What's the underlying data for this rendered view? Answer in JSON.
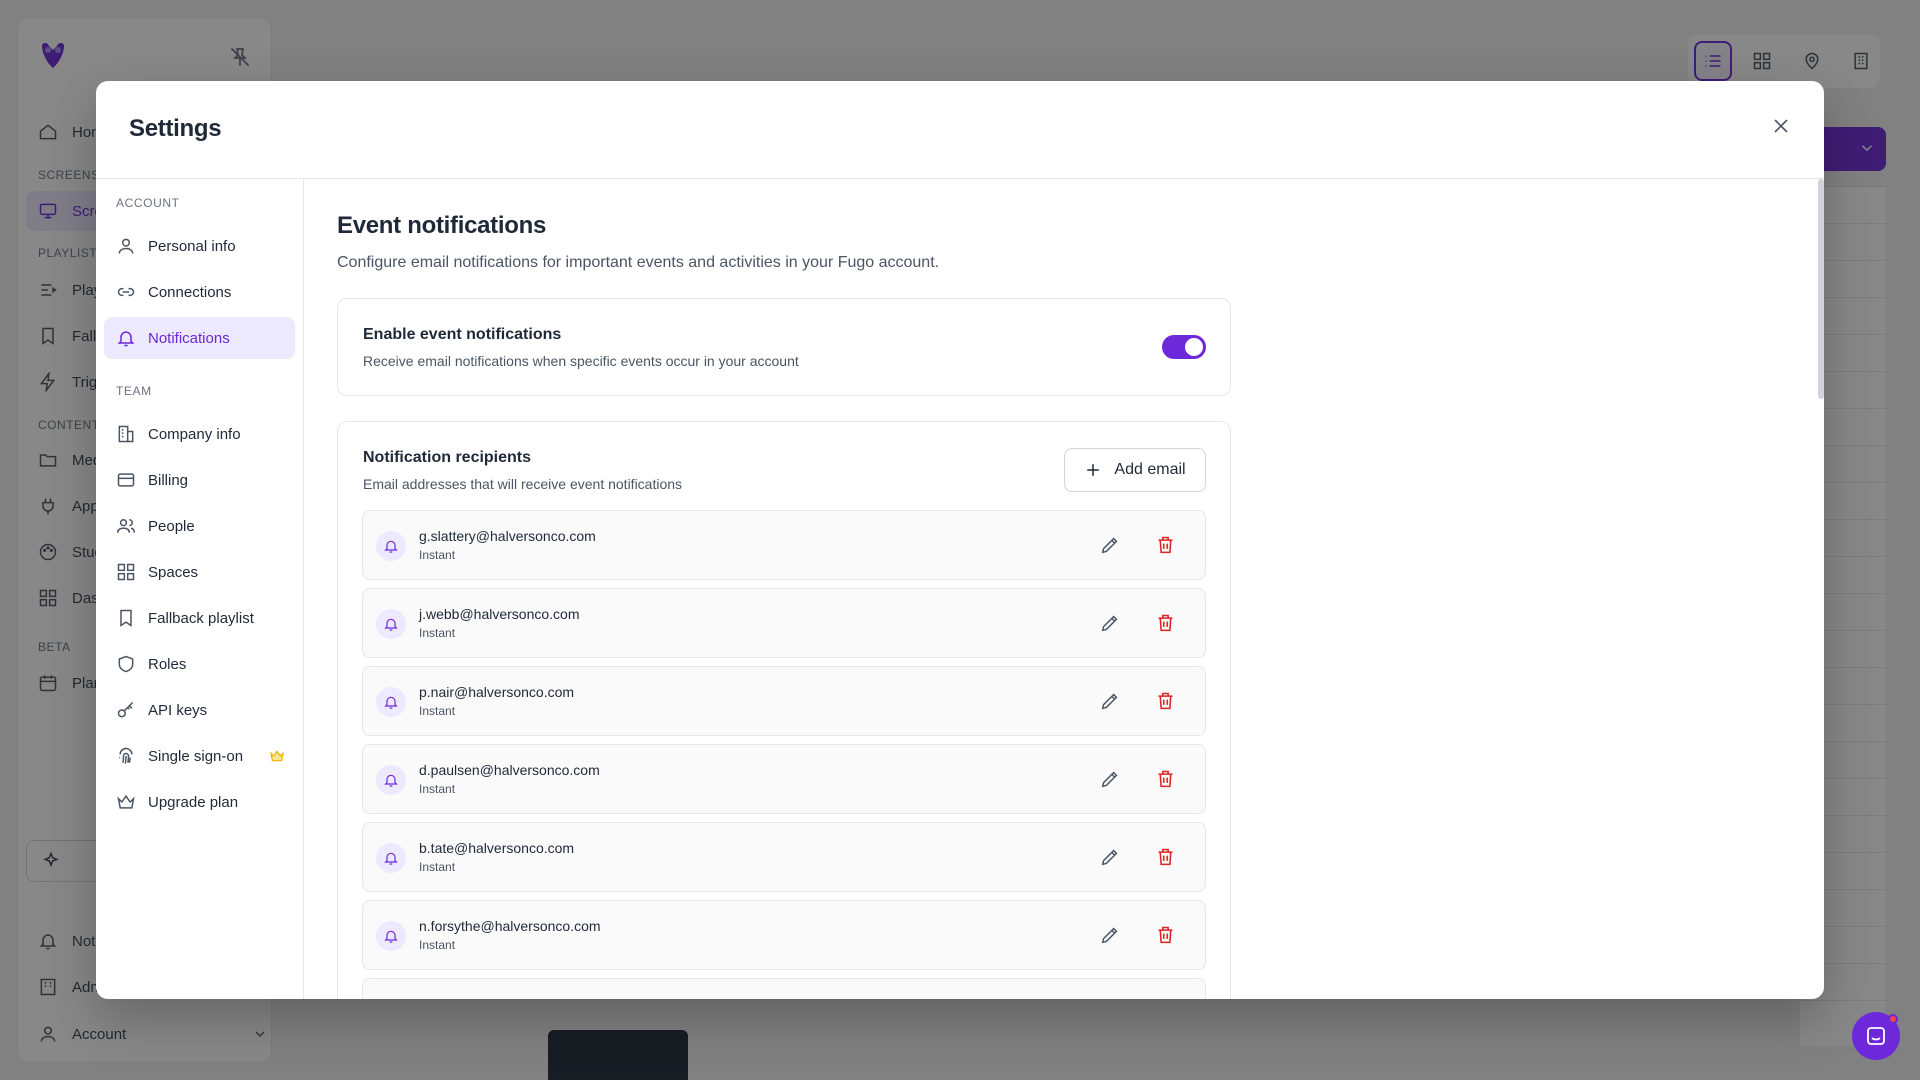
{
  "background": {
    "sidebar": {
      "sections": [
        "SCREENS",
        "PLAYLIST",
        "CONTENT",
        "BETA"
      ],
      "items": [
        "Hom",
        "Scre",
        "Play",
        "Fall",
        "Trig",
        "Med",
        "App",
        "Stud",
        "Das",
        "Plan",
        "Noti",
        "Adm"
      ],
      "account_label": "Account"
    }
  },
  "modal": {
    "title": "Settings",
    "nav": {
      "account_section": "ACCOUNT",
      "account_items": [
        "Personal info",
        "Connections",
        "Notifications"
      ],
      "team_section": "TEAM",
      "team_items": [
        "Company info",
        "Billing",
        "People",
        "Spaces",
        "Fallback playlist",
        "Roles",
        "API keys",
        "Single sign-on",
        "Upgrade plan"
      ],
      "active": "Notifications"
    },
    "content": {
      "heading": "Event notifications",
      "description": "Configure email notifications for important events and activities in your Fugo account.",
      "toggle_card": {
        "title": "Enable event notifications",
        "subtitle": "Receive email notifications when specific events occur in your account",
        "enabled": true
      },
      "recipients": {
        "title": "Notification recipients",
        "subtitle": "Email addresses that will receive event notifications",
        "add_button": "Add email",
        "list": [
          {
            "email": "g.slattery@halversonco.com",
            "frequency": "Instant"
          },
          {
            "email": "j.webb@halversonco.com",
            "frequency": "Instant"
          },
          {
            "email": "p.nair@halversonco.com",
            "frequency": "Instant"
          },
          {
            "email": "d.paulsen@halversonco.com",
            "frequency": "Instant"
          },
          {
            "email": "b.tate@halversonco.com",
            "frequency": "Instant"
          },
          {
            "email": "n.forsythe@halversonco.com",
            "frequency": "Instant"
          }
        ]
      }
    }
  },
  "colors": {
    "accent": "#6d28d9",
    "danger": "#dc2626",
    "badge": "#eab308"
  }
}
